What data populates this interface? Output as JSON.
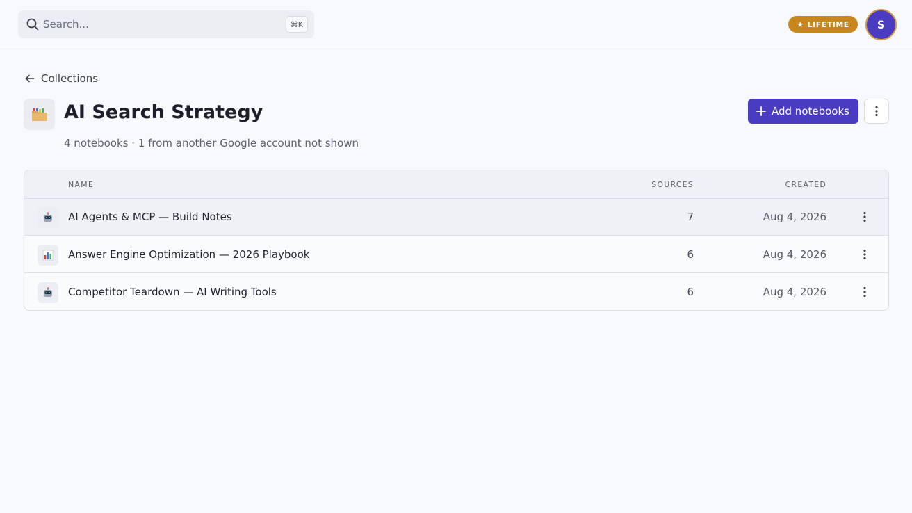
{
  "search": {
    "placeholder": "Search...",
    "shortcut": "⌘K"
  },
  "badge": {
    "label": "LIFETIME",
    "icon": "star-icon",
    "color": "#c8871c"
  },
  "user": {
    "initial": "S",
    "color": "#4a3cc0"
  },
  "breadcrumb": {
    "label": "Collections"
  },
  "collection": {
    "title": "AI Search Strategy",
    "subtitle": "4 notebooks · 1 from another Google account not shown",
    "icon": "folder-icon"
  },
  "actions": {
    "add_label": "Add notebooks",
    "accent": "#4a3cc0"
  },
  "table": {
    "columns": {
      "name": "NAME",
      "sources": "SOURCES",
      "created": "CREATED"
    },
    "rows": [
      {
        "name": "AI Agents & MCP — Build Notes",
        "sources": "7",
        "created": "Aug 4, 2026",
        "icon": "robot-icon"
      },
      {
        "name": "Answer Engine Optimization — 2026 Playbook",
        "sources": "6",
        "created": "Aug 4, 2026",
        "icon": "bar-chart-icon"
      },
      {
        "name": "Competitor Teardown — AI Writing Tools",
        "sources": "6",
        "created": "Aug 4, 2026",
        "icon": "robot-icon"
      }
    ]
  }
}
